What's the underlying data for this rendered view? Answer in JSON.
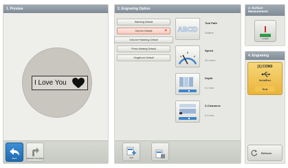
{
  "preview": {
    "title": "1. Preview",
    "engrave_text": "I Love You",
    "buttons": [
      {
        "label": "Back"
      },
      {
        "label": "Reselect Template"
      }
    ]
  },
  "options": {
    "title": "2. Engraving Option",
    "methods": [
      {
        "label": "Hatching Default"
      },
      {
        "label": "OutLine Default"
      },
      {
        "label": "OutLine+Hatching Default"
      },
      {
        "label": "Photo-Marking Default"
      },
      {
        "label": "SingleLine Default"
      }
    ],
    "selected_method": "OutLine Default",
    "params": [
      {
        "title": "Tool Path",
        "value": "Outline"
      },
      {
        "title": "Speed",
        "value": "30 mm/s"
      },
      {
        "title": "Depth",
        "value": "0.2 mm"
      },
      {
        "title": "Z-Clearance",
        "value": "0.5 mm"
      }
    ],
    "footer_buttons": [
      {
        "label": "Add"
      },
      {
        "label": ""
      }
    ]
  },
  "surface": {
    "title": "3. Surface Measurement",
    "button_label": "Length"
  },
  "engraving": {
    "title": "4. Engraving",
    "port": "[1] COM3",
    "port_type": "SerialPort",
    "exit_label": "Exit",
    "refresh_label": "Refresh"
  },
  "colors": {
    "header": "#8c97a1",
    "panel": "#e7e8e3",
    "accent_blue": "#2a7bc6",
    "selected": "#f7c9be",
    "com_card": "#efc24f"
  }
}
